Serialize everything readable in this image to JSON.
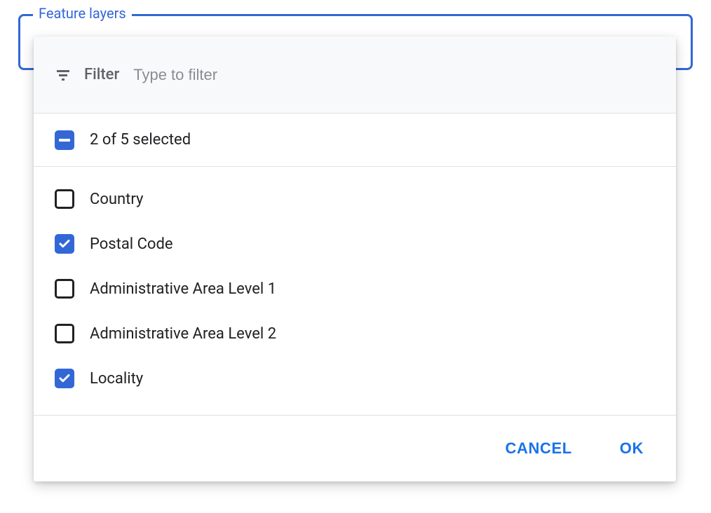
{
  "field": {
    "legend": "Feature layers"
  },
  "filter": {
    "label": "Filter",
    "placeholder": "Type to filter"
  },
  "summary": {
    "text": "2 of 5 selected",
    "state": "indeterminate"
  },
  "options": [
    {
      "label": "Country",
      "checked": false
    },
    {
      "label": "Postal Code",
      "checked": true
    },
    {
      "label": "Administrative Area Level 1",
      "checked": false
    },
    {
      "label": "Administrative Area Level 2",
      "checked": false
    },
    {
      "label": "Locality",
      "checked": true
    }
  ],
  "actions": {
    "cancel": "CANCEL",
    "ok": "OK"
  },
  "colors": {
    "accent": "#3367d6",
    "accent_bright": "#1a73e8"
  }
}
